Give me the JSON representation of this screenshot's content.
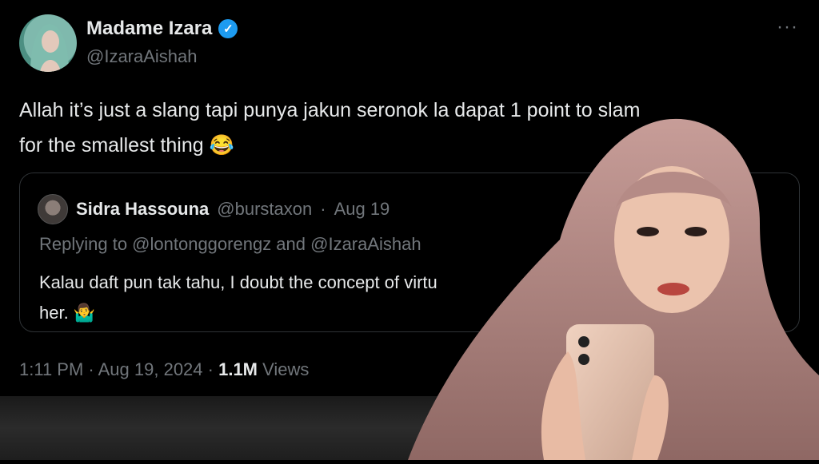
{
  "author": {
    "name": "Madame Izara",
    "handle": "@IzaraAishah",
    "verified_icon": "verified-check-icon",
    "more_label": "···"
  },
  "tweet": {
    "line1": "Allah it’s just a slang tapi punya jakun seronok la dapat 1 point to slam",
    "line2": "for the smallest thing 😂"
  },
  "quote": {
    "name": "Sidra Hassouna",
    "handle": "@burstaxon",
    "sep": "·",
    "date": "Aug 19",
    "replying": "Replying to @lontonggorengz and @IzaraAishah",
    "line1": "Kalau daft pun tak tahu, I doubt the concept of virtu",
    "line2": "her. 🤷‍♂️"
  },
  "meta": {
    "time": "1:11 PM · Aug 19, 2024 · ",
    "views_count": "1.1M",
    "views_label": " Views"
  },
  "colors": {
    "background": "#000000",
    "text": "#e7e9ea",
    "muted": "#71767b",
    "accent": "#1d9bf0",
    "border": "#2f3336"
  }
}
